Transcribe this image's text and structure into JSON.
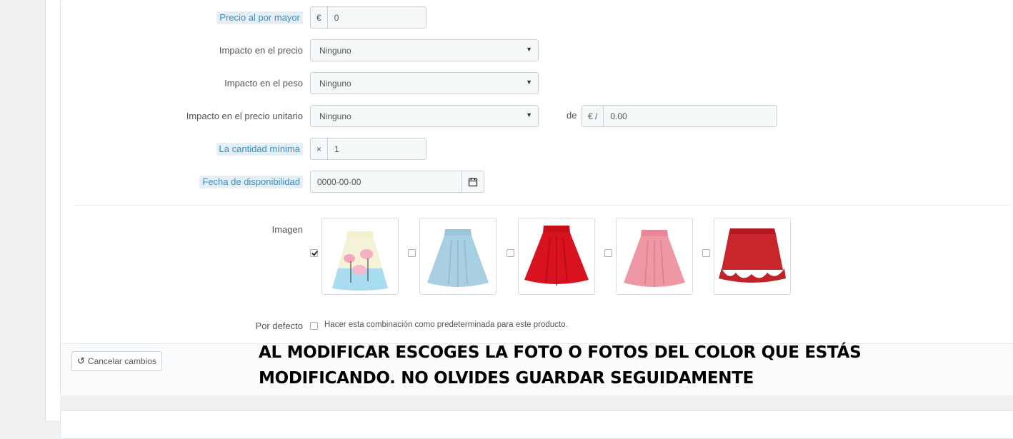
{
  "fields": {
    "wholesale_price": {
      "label": "Precio al por mayor",
      "addon": "€",
      "value": "0"
    },
    "price_impact": {
      "label": "Impacto en el precio",
      "selected": "Ninguno"
    },
    "weight_impact": {
      "label": "Impacto en el peso",
      "selected": "Ninguno"
    },
    "unit_price_impact": {
      "label": "Impacto en el precio unitario",
      "selected": "Ninguno",
      "of_label": "de",
      "addon": "€ /",
      "value": "0.00"
    },
    "min_quantity": {
      "label": "La cantidad mínima",
      "addon": "×",
      "value": "1"
    },
    "availability_date": {
      "label": "Fecha de disponibilidad",
      "value": "0000-00-00"
    }
  },
  "images": {
    "label": "Imagen",
    "items": [
      {
        "checked": true,
        "color": "#f3b2c4"
      },
      {
        "checked": false,
        "color": "#a9cfe3"
      },
      {
        "checked": false,
        "color": "#d8121e"
      },
      {
        "checked": false,
        "color": "#ee98a6"
      },
      {
        "checked": false,
        "color": "#c8262c"
      }
    ]
  },
  "default": {
    "label": "Por defecto",
    "checkbox_text": "Hacer esta combinación como predeterminada para este producto."
  },
  "footer": {
    "cancel_label": "Cancelar cambios"
  },
  "overlay": {
    "line1": "AL MODIFICAR ESCOGES LA FOTO O FOTOS DEL COLOR QUE ESTÁS",
    "line2": "MODIFICANDO. NO OLVIDES GUARDAR SEGUIDAMENTE"
  }
}
